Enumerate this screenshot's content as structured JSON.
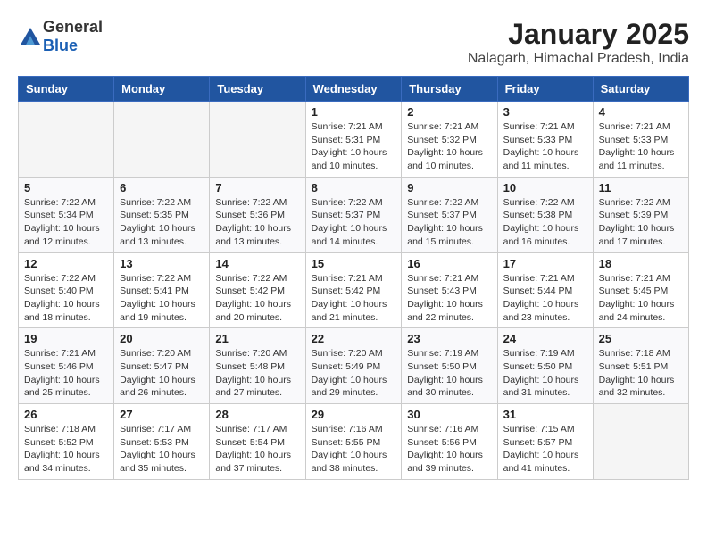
{
  "header": {
    "logo_general": "General",
    "logo_blue": "Blue",
    "month": "January 2025",
    "location": "Nalagarh, Himachal Pradesh, India"
  },
  "weekdays": [
    "Sunday",
    "Monday",
    "Tuesday",
    "Wednesday",
    "Thursday",
    "Friday",
    "Saturday"
  ],
  "weeks": [
    [
      {
        "day": "",
        "sunrise": "",
        "sunset": "",
        "daylight": ""
      },
      {
        "day": "",
        "sunrise": "",
        "sunset": "",
        "daylight": ""
      },
      {
        "day": "",
        "sunrise": "",
        "sunset": "",
        "daylight": ""
      },
      {
        "day": "1",
        "sunrise": "Sunrise: 7:21 AM",
        "sunset": "Sunset: 5:31 PM",
        "daylight": "Daylight: 10 hours and 10 minutes."
      },
      {
        "day": "2",
        "sunrise": "Sunrise: 7:21 AM",
        "sunset": "Sunset: 5:32 PM",
        "daylight": "Daylight: 10 hours and 10 minutes."
      },
      {
        "day": "3",
        "sunrise": "Sunrise: 7:21 AM",
        "sunset": "Sunset: 5:33 PM",
        "daylight": "Daylight: 10 hours and 11 minutes."
      },
      {
        "day": "4",
        "sunrise": "Sunrise: 7:21 AM",
        "sunset": "Sunset: 5:33 PM",
        "daylight": "Daylight: 10 hours and 11 minutes."
      }
    ],
    [
      {
        "day": "5",
        "sunrise": "Sunrise: 7:22 AM",
        "sunset": "Sunset: 5:34 PM",
        "daylight": "Daylight: 10 hours and 12 minutes."
      },
      {
        "day": "6",
        "sunrise": "Sunrise: 7:22 AM",
        "sunset": "Sunset: 5:35 PM",
        "daylight": "Daylight: 10 hours and 13 minutes."
      },
      {
        "day": "7",
        "sunrise": "Sunrise: 7:22 AM",
        "sunset": "Sunset: 5:36 PM",
        "daylight": "Daylight: 10 hours and 13 minutes."
      },
      {
        "day": "8",
        "sunrise": "Sunrise: 7:22 AM",
        "sunset": "Sunset: 5:37 PM",
        "daylight": "Daylight: 10 hours and 14 minutes."
      },
      {
        "day": "9",
        "sunrise": "Sunrise: 7:22 AM",
        "sunset": "Sunset: 5:37 PM",
        "daylight": "Daylight: 10 hours and 15 minutes."
      },
      {
        "day": "10",
        "sunrise": "Sunrise: 7:22 AM",
        "sunset": "Sunset: 5:38 PM",
        "daylight": "Daylight: 10 hours and 16 minutes."
      },
      {
        "day": "11",
        "sunrise": "Sunrise: 7:22 AM",
        "sunset": "Sunset: 5:39 PM",
        "daylight": "Daylight: 10 hours and 17 minutes."
      }
    ],
    [
      {
        "day": "12",
        "sunrise": "Sunrise: 7:22 AM",
        "sunset": "Sunset: 5:40 PM",
        "daylight": "Daylight: 10 hours and 18 minutes."
      },
      {
        "day": "13",
        "sunrise": "Sunrise: 7:22 AM",
        "sunset": "Sunset: 5:41 PM",
        "daylight": "Daylight: 10 hours and 19 minutes."
      },
      {
        "day": "14",
        "sunrise": "Sunrise: 7:22 AM",
        "sunset": "Sunset: 5:42 PM",
        "daylight": "Daylight: 10 hours and 20 minutes."
      },
      {
        "day": "15",
        "sunrise": "Sunrise: 7:21 AM",
        "sunset": "Sunset: 5:42 PM",
        "daylight": "Daylight: 10 hours and 21 minutes."
      },
      {
        "day": "16",
        "sunrise": "Sunrise: 7:21 AM",
        "sunset": "Sunset: 5:43 PM",
        "daylight": "Daylight: 10 hours and 22 minutes."
      },
      {
        "day": "17",
        "sunrise": "Sunrise: 7:21 AM",
        "sunset": "Sunset: 5:44 PM",
        "daylight": "Daylight: 10 hours and 23 minutes."
      },
      {
        "day": "18",
        "sunrise": "Sunrise: 7:21 AM",
        "sunset": "Sunset: 5:45 PM",
        "daylight": "Daylight: 10 hours and 24 minutes."
      }
    ],
    [
      {
        "day": "19",
        "sunrise": "Sunrise: 7:21 AM",
        "sunset": "Sunset: 5:46 PM",
        "daylight": "Daylight: 10 hours and 25 minutes."
      },
      {
        "day": "20",
        "sunrise": "Sunrise: 7:20 AM",
        "sunset": "Sunset: 5:47 PM",
        "daylight": "Daylight: 10 hours and 26 minutes."
      },
      {
        "day": "21",
        "sunrise": "Sunrise: 7:20 AM",
        "sunset": "Sunset: 5:48 PM",
        "daylight": "Daylight: 10 hours and 27 minutes."
      },
      {
        "day": "22",
        "sunrise": "Sunrise: 7:20 AM",
        "sunset": "Sunset: 5:49 PM",
        "daylight": "Daylight: 10 hours and 29 minutes."
      },
      {
        "day": "23",
        "sunrise": "Sunrise: 7:19 AM",
        "sunset": "Sunset: 5:50 PM",
        "daylight": "Daylight: 10 hours and 30 minutes."
      },
      {
        "day": "24",
        "sunrise": "Sunrise: 7:19 AM",
        "sunset": "Sunset: 5:50 PM",
        "daylight": "Daylight: 10 hours and 31 minutes."
      },
      {
        "day": "25",
        "sunrise": "Sunrise: 7:18 AM",
        "sunset": "Sunset: 5:51 PM",
        "daylight": "Daylight: 10 hours and 32 minutes."
      }
    ],
    [
      {
        "day": "26",
        "sunrise": "Sunrise: 7:18 AM",
        "sunset": "Sunset: 5:52 PM",
        "daylight": "Daylight: 10 hours and 34 minutes."
      },
      {
        "day": "27",
        "sunrise": "Sunrise: 7:17 AM",
        "sunset": "Sunset: 5:53 PM",
        "daylight": "Daylight: 10 hours and 35 minutes."
      },
      {
        "day": "28",
        "sunrise": "Sunrise: 7:17 AM",
        "sunset": "Sunset: 5:54 PM",
        "daylight": "Daylight: 10 hours and 37 minutes."
      },
      {
        "day": "29",
        "sunrise": "Sunrise: 7:16 AM",
        "sunset": "Sunset: 5:55 PM",
        "daylight": "Daylight: 10 hours and 38 minutes."
      },
      {
        "day": "30",
        "sunrise": "Sunrise: 7:16 AM",
        "sunset": "Sunset: 5:56 PM",
        "daylight": "Daylight: 10 hours and 39 minutes."
      },
      {
        "day": "31",
        "sunrise": "Sunrise: 7:15 AM",
        "sunset": "Sunset: 5:57 PM",
        "daylight": "Daylight: 10 hours and 41 minutes."
      },
      {
        "day": "",
        "sunrise": "",
        "sunset": "",
        "daylight": ""
      }
    ]
  ]
}
